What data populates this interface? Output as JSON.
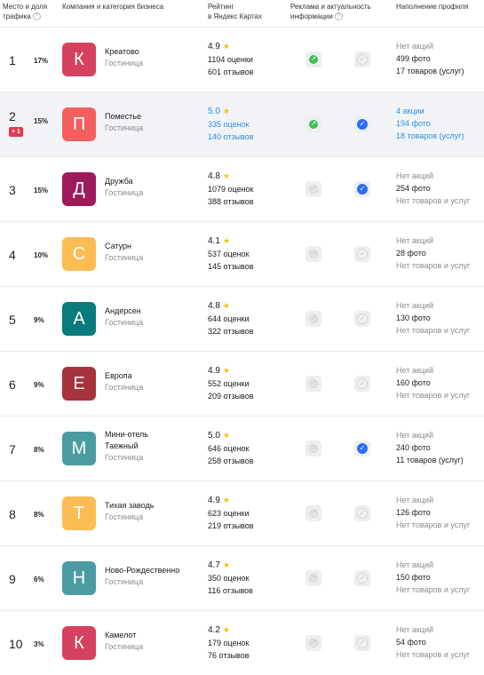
{
  "header": {
    "col_place": [
      "Место и доля",
      "трафика"
    ],
    "col_company": "Компания и категория бизнеса",
    "col_rating": [
      "Рейтинг",
      "в Яндекс Картах"
    ],
    "col_ads": [
      "Реклама и актуальность",
      "информации"
    ],
    "col_profile": "Наполнение профиля",
    "help_icon": "question-circle-icon"
  },
  "colors": {
    "highlight_bg": "#f2f3f7",
    "link_blue": "#2b8fe0",
    "delta_red": "#e8384f",
    "ad_green": "#3fbf57",
    "check_blue": "#2a6ff5",
    "star_yellow": "#f5c400"
  },
  "rows": [
    {
      "place": "1",
      "share": "17%",
      "delta": "",
      "letter": "К",
      "color": "#d5415f",
      "name": [
        "Креатово"
      ],
      "category": "Гостиница",
      "score": "4.9",
      "ratings": "1104 оценки",
      "reviews": "601 отзывов",
      "ad": true,
      "actual": false,
      "promos": "Нет акций",
      "photos": "499 фото",
      "goods": "17 товаров (услуг)",
      "promo_active": false,
      "blue": false
    },
    {
      "place": "2",
      "share": "15%",
      "delta": "+ 1",
      "letter": "П",
      "color": "#f35f5f",
      "name": [
        "Поместье"
      ],
      "category": "Гостиница",
      "score": "5.0",
      "ratings": "335 оценок",
      "reviews": "140 отзывов",
      "ad": true,
      "actual": true,
      "promos": "4 акции",
      "photos": "194 фото",
      "goods": "18 товаров (услуг)",
      "promo_active": true,
      "blue": true
    },
    {
      "place": "3",
      "share": "15%",
      "delta": "",
      "letter": "Д",
      "color": "#9d1b5c",
      "name": [
        "Дружба"
      ],
      "category": "Гостиница",
      "score": "4.8",
      "ratings": "1079 оценок",
      "reviews": "388 отзывов",
      "ad": false,
      "actual": true,
      "promos": "Нет акций",
      "photos": "254 фото",
      "goods": "Нет товаров и услуг",
      "promo_active": false,
      "blue": false
    },
    {
      "place": "4",
      "share": "10%",
      "delta": "",
      "letter": "С",
      "color": "#fbbd53",
      "name": [
        "Сатурн"
      ],
      "category": "Гостиница",
      "score": "4.1",
      "ratings": "537 оценок",
      "reviews": "145 отзывов",
      "ad": false,
      "actual": false,
      "promos": "Нет акций",
      "photos": "28 фото",
      "goods": "Нет товаров и услуг",
      "promo_active": false,
      "blue": false
    },
    {
      "place": "5",
      "share": "9%",
      "delta": "",
      "letter": "А",
      "color": "#097b7c",
      "name": [
        "Андерсен"
      ],
      "category": "Гостиница",
      "score": "4.8",
      "ratings": "644 оценки",
      "reviews": "322 отзывов",
      "ad": false,
      "actual": false,
      "promos": "Нет акций",
      "photos": "130 фото",
      "goods": "Нет товаров и услуг",
      "promo_active": false,
      "blue": false
    },
    {
      "place": "6",
      "share": "9%",
      "delta": "",
      "letter": "Е",
      "color": "#a6333b",
      "name": [
        "Европа"
      ],
      "category": "Гостиница",
      "score": "4.9",
      "ratings": "552 оценки",
      "reviews": "209 отзывов",
      "ad": false,
      "actual": false,
      "promos": "Нет акций",
      "photos": "160 фото",
      "goods": "Нет товаров и услуг",
      "promo_active": false,
      "blue": false
    },
    {
      "place": "7",
      "share": "8%",
      "delta": "",
      "letter": "М",
      "color": "#4b9ca2",
      "name": [
        "Мини-отель",
        "Таежный"
      ],
      "category": "Гостиница",
      "score": "5.0",
      "ratings": "646 оценок",
      "reviews": "258 отзывов",
      "ad": false,
      "actual": true,
      "promos": "Нет акций",
      "photos": "240 фото",
      "goods": "11 товаров (услуг)",
      "promo_active": false,
      "blue": false
    },
    {
      "place": "8",
      "share": "8%",
      "delta": "",
      "letter": "Т",
      "color": "#fbbd53",
      "name": [
        "Тихая заводь"
      ],
      "category": "Гостиница",
      "score": "4.9",
      "ratings": "623 оценки",
      "reviews": "219 отзывов",
      "ad": false,
      "actual": false,
      "promos": "Нет акций",
      "photos": "126 фото",
      "goods": "Нет товаров и услуг",
      "promo_active": false,
      "blue": false
    },
    {
      "place": "9",
      "share": "6%",
      "delta": "",
      "letter": "Н",
      "color": "#4b9ca2",
      "name": [
        "Ново-Рождественно"
      ],
      "category": "Гостиница",
      "score": "4.7",
      "ratings": "350 оценок",
      "reviews": "116 отзывов",
      "ad": false,
      "actual": false,
      "promos": "Нет акций",
      "photos": "150 фото",
      "goods": "Нет товаров и услуг",
      "promo_active": false,
      "blue": false
    },
    {
      "place": "10",
      "share": "3%",
      "delta": "",
      "letter": "К",
      "color": "#d5415f",
      "name": [
        "Камелот"
      ],
      "category": "Гостиница",
      "score": "4.2",
      "ratings": "179 оценок",
      "reviews": "76 отзывов",
      "ad": false,
      "actual": false,
      "promos": "Нет акций",
      "photos": "54 фото",
      "goods": "Нет товаров и услуг",
      "promo_active": false,
      "blue": false
    }
  ]
}
